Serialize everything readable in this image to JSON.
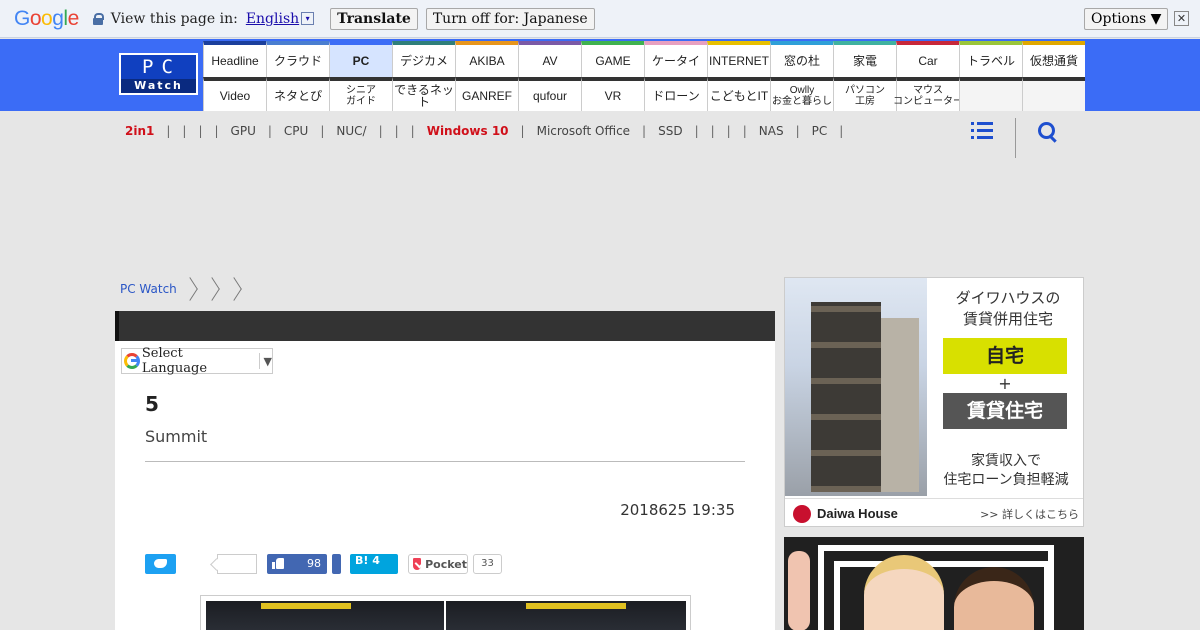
{
  "translate_bar": {
    "logo": [
      "G",
      "o",
      "o",
      "g",
      "l",
      "e"
    ],
    "prompt": "View this page in:",
    "language": "English",
    "dropdown_glyph": "▾",
    "translate_label": "Translate",
    "turn_off_label": "Turn off for: Japanese",
    "options_label": "Options ▼",
    "close_glyph": "✕"
  },
  "site": {
    "logo_top": "PC",
    "logo_bottom": "Watch"
  },
  "nav": {
    "row1": [
      "Headline",
      "クラウド",
      "PC",
      "デジカメ",
      "AKIBA",
      "AV",
      "GAME",
      "ケータイ",
      "INTERNET",
      "窓の杜",
      "家電",
      "Car",
      "トラベル",
      "仮想通貨"
    ],
    "row1_colors": [
      "#1b3f9c",
      "#4a7ed0",
      "#3b6cf6",
      "#2f7f7a",
      "#e8961c",
      "#7b5aa6",
      "#3fb24f",
      "#e8a0c0",
      "#e8c000",
      "#2fa0d8",
      "#3fb2a0",
      "#c8283a",
      "#9bc63a",
      "#e0a800"
    ],
    "row2": [
      "Video",
      "ネタとぴ",
      "シニア\nガイド",
      "できるネット",
      "GANREF",
      "qufour",
      "VR",
      "ドローン",
      "こどもとIT",
      "Owlly\nお金と暮らし",
      "パソコン\n工房",
      "マウス\nコンピューター",
      "",
      ""
    ],
    "selected": "PC"
  },
  "subnav": {
    "items": [
      {
        "label": "2in1",
        "red": true
      },
      {
        "label": "|"
      },
      {
        "label": "|"
      },
      {
        "label": "|"
      },
      {
        "label": "|"
      },
      {
        "label": "GPU"
      },
      {
        "label": "|"
      },
      {
        "label": "CPU"
      },
      {
        "label": "|"
      },
      {
        "label": "NUC/"
      },
      {
        "label": "|"
      },
      {
        "label": "|"
      },
      {
        "label": "|"
      },
      {
        "label": "Windows 10",
        "red": true
      },
      {
        "label": "|"
      },
      {
        "label": "Microsoft Office"
      },
      {
        "label": "|"
      },
      {
        "label": "SSD"
      },
      {
        "label": "|"
      },
      {
        "label": "|"
      },
      {
        "label": "|"
      },
      {
        "label": "|"
      },
      {
        "label": "NAS"
      },
      {
        "label": "|"
      },
      {
        "label": "PC"
      },
      {
        "label": "|"
      }
    ]
  },
  "breadcrumb": {
    "home": "PC Watch"
  },
  "article": {
    "translate_widget": "Select Language",
    "translate_arrow": "▼",
    "title": "5",
    "subtitle": "Summit",
    "date": "2018625 19:35"
  },
  "share": {
    "fb_like_count": "98",
    "hatena_label": "B! 4",
    "pocket_label": "Pocket",
    "pocket_count": "33"
  },
  "ads": {
    "daiwa": {
      "line1": "ダイワハウスの",
      "line2": "賃貸併用住宅",
      "box1": "自宅",
      "plus": "+",
      "box2": "賃貸住宅",
      "line3": "家賃収入で",
      "line4": "住宅ローン負担軽減",
      "brand": "Daiwa House",
      "more": ">> 詳しくはこちら"
    }
  }
}
